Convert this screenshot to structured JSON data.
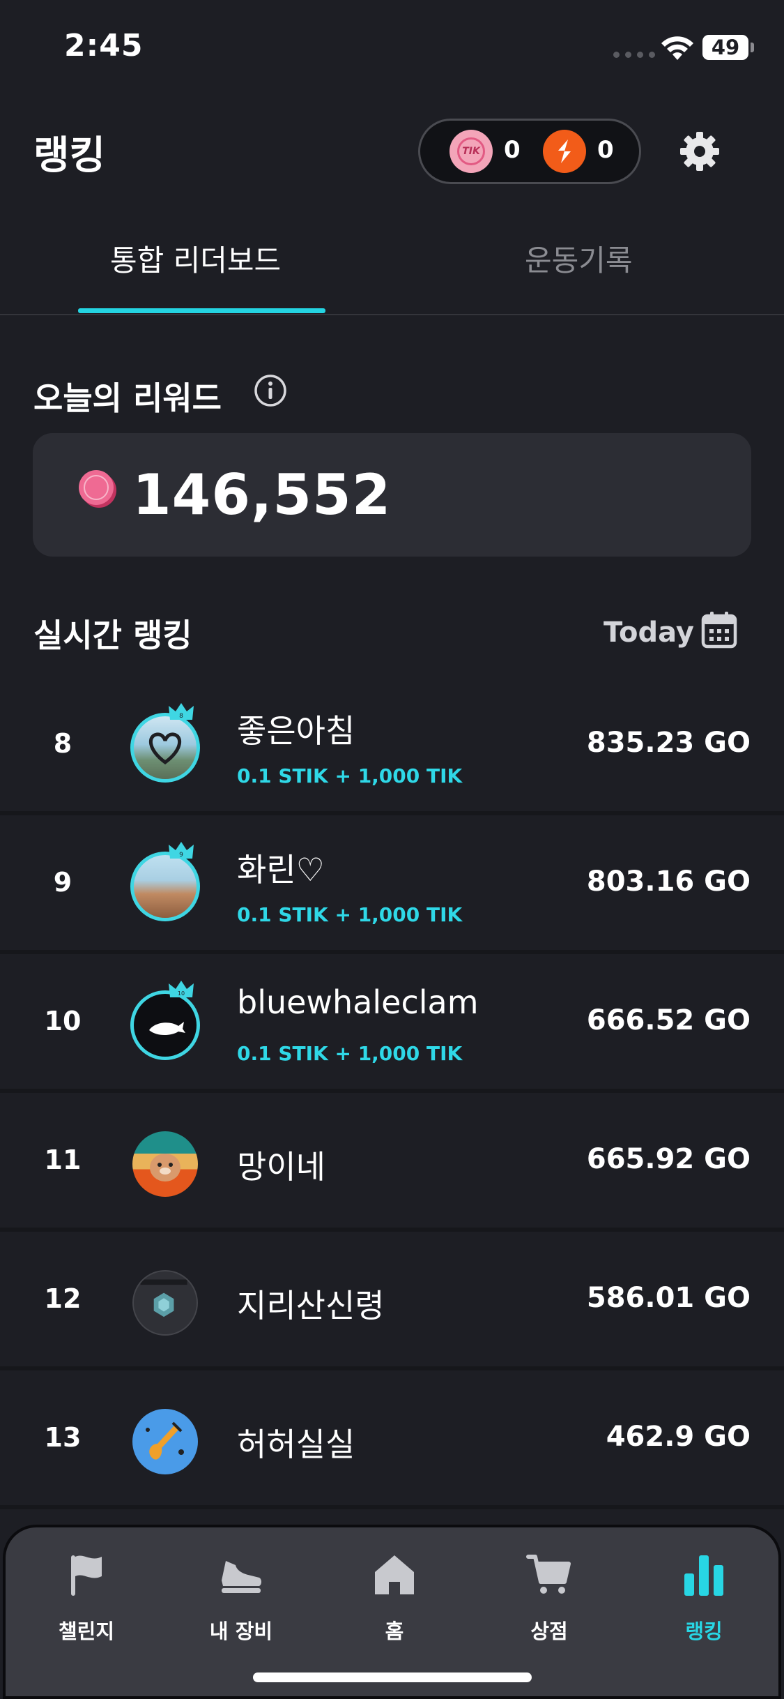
{
  "status_bar": {
    "time": "2:45",
    "battery": "49"
  },
  "header": {
    "title": "랭킹",
    "tik_coin_label": "TIK",
    "tik_balance": "0",
    "stik_balance": "0"
  },
  "tabs": [
    {
      "label": "통합 리더보드",
      "active": true
    },
    {
      "label": "운동기록",
      "active": false
    }
  ],
  "today_reward": {
    "title": "오늘의 리워드",
    "value": "146,552"
  },
  "live_ranking": {
    "title": "실시간 랭킹",
    "period": "Today",
    "rows": [
      {
        "rank": "8",
        "name": "좋은아침",
        "reward": "0.1 STIK + 1,000 TIK",
        "score": "835.23 GO"
      },
      {
        "rank": "9",
        "name": "화린♡",
        "reward": "0.1 STIK + 1,000 TIK",
        "score": "803.16 GO"
      },
      {
        "rank": "10",
        "name": "bluewhaleclam",
        "reward": "0.1 STIK + 1,000 TIK",
        "score": "666.52 GO"
      },
      {
        "rank": "11",
        "name": "망이네",
        "reward": "",
        "score": "665.92 GO"
      },
      {
        "rank": "12",
        "name": "지리산신령",
        "reward": "",
        "score": "586.01 GO"
      },
      {
        "rank": "13",
        "name": "허허실실",
        "reward": "",
        "score": "462.9 GO"
      }
    ]
  },
  "bottom_nav": [
    {
      "label": "챌린지",
      "icon": "flag-icon"
    },
    {
      "label": "내 장비",
      "icon": "sneaker-icon"
    },
    {
      "label": "홈",
      "icon": "home-icon"
    },
    {
      "label": "상점",
      "icon": "cart-icon"
    },
    {
      "label": "랭킹",
      "icon": "bar-chart-icon",
      "active": true
    }
  ],
  "colors": {
    "background": "#1d1e24",
    "accent": "#24d4e2",
    "tik_pink": "#f3a5b9",
    "stik_orange": "#f25c19"
  }
}
